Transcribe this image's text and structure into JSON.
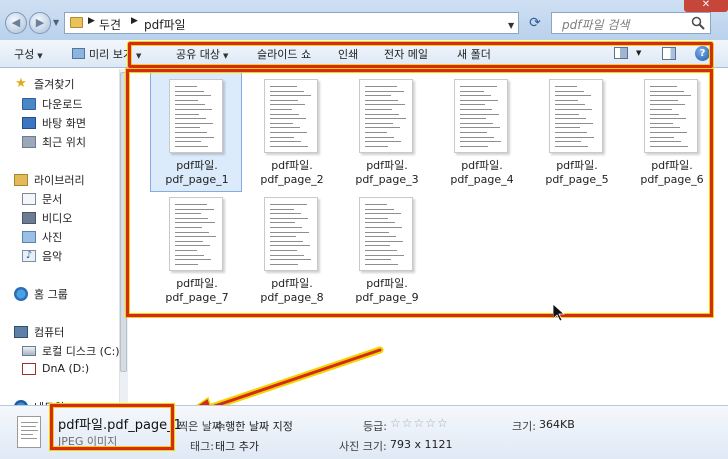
{
  "address": {
    "crumbs": [
      "두견",
      "pdf파일"
    ],
    "search_placeholder": "pdf파일 검색"
  },
  "toolbar": {
    "organize": "구성",
    "preview": "미리 보기",
    "share": "공유 대상",
    "slideshow": "슬라이드 쇼",
    "print": "인쇄",
    "email": "전자 메일",
    "new_folder": "새 폴더"
  },
  "sidebar": {
    "favorites": {
      "label": "즐겨찾기",
      "items": [
        "다운로드",
        "바탕 화면",
        "최근 위치"
      ]
    },
    "libraries": {
      "label": "라이브러리",
      "items": [
        "문서",
        "비디오",
        "사진",
        "음악"
      ]
    },
    "homegroup": "홈 그룹",
    "computer": {
      "label": "컴퓨터",
      "items": [
        "로컬 디스크 (C:)",
        "DnA (D:)"
      ]
    },
    "network": "네트워크"
  },
  "files": [
    {
      "line1": "pdf파일.",
      "line2": "pdf_page_1",
      "selected": true
    },
    {
      "line1": "pdf파일.",
      "line2": "pdf_page_2",
      "selected": false
    },
    {
      "line1": "pdf파일.",
      "line2": "pdf_page_3",
      "selected": false
    },
    {
      "line1": "pdf파일.",
      "line2": "pdf_page_4",
      "selected": false
    },
    {
      "line1": "pdf파일.",
      "line2": "pdf_page_5",
      "selected": false
    },
    {
      "line1": "pdf파일.",
      "line2": "pdf_page_6",
      "selected": false
    },
    {
      "line1": "pdf파일.",
      "line2": "pdf_page_7",
      "selected": false
    },
    {
      "line1": "pdf파일.",
      "line2": "pdf_page_8",
      "selected": false
    },
    {
      "line1": "pdf파일.",
      "line2": "pdf_page_9",
      "selected": false
    }
  ],
  "details": {
    "filename": "pdf파일.pdf_page_1",
    "filetype": "JPEG 이미지",
    "date_label": "찍은 날짜:",
    "date_value": "수행한 날짜 지정",
    "tag_label": "태그:",
    "tag_value": "태그 추가",
    "rating_label": "등급:",
    "rating_value": "☆☆☆☆☆",
    "dimensions_label": "사진 크기:",
    "dimensions_value": "793 x 1121",
    "size_label": "크기:",
    "size_value": "364KB"
  },
  "colors": {
    "highlight_border": "#d42a1a",
    "highlight_glow": "#f2d500",
    "selection_fill": "#dcebfc"
  }
}
